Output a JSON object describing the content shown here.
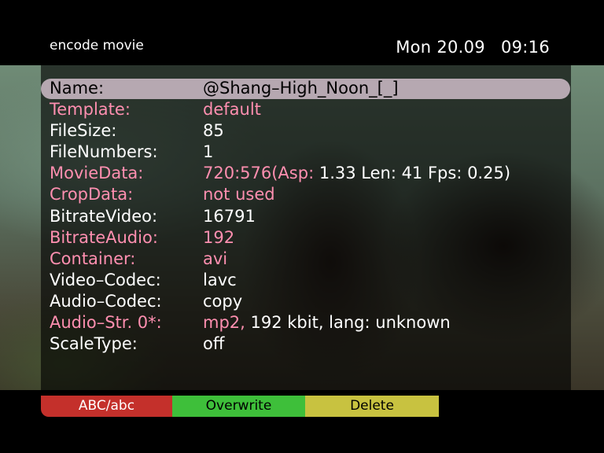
{
  "header": {
    "title": "encode movie",
    "date": "Mon 20.09",
    "time": "09:16"
  },
  "fields": [
    {
      "label": "Name:",
      "value": "@Shang–High_Noon_[_]",
      "selected": true
    },
    {
      "label": "Template:",
      "value": "default"
    },
    {
      "label": "FileSize:",
      "value": "85"
    },
    {
      "label": "FileNumbers:",
      "value": "1"
    },
    {
      "label": "MovieData:",
      "value_parts": [
        "720:576(Asp: ",
        "1.33 Len: 41 Fps: 0.25)"
      ]
    },
    {
      "label": "CropData:",
      "value": "not used"
    },
    {
      "label": "BitrateVideo:",
      "value": "16791"
    },
    {
      "label": "BitrateAudio:",
      "value": "192"
    },
    {
      "label": "Container:",
      "value": "avi"
    },
    {
      "label": "Video–Codec:",
      "value": "lavc"
    },
    {
      "label": "Audio–Codec:",
      "value": "copy"
    },
    {
      "label": "Audio–Str. 0*:",
      "value_parts": [
        "mp2, ",
        "192 kbit, lang: unknown"
      ]
    },
    {
      "label": "ScaleType:",
      "value": "off"
    }
  ],
  "buttons": {
    "red": "ABC/abc",
    "green": "Overwrite",
    "yellow": "Delete"
  },
  "colors": {
    "highlight": "#b6a8b1",
    "text_pink": "#ff8fb0",
    "text_white": "#ffffff",
    "button_red": "#c4302b",
    "button_green": "#3ebf3a",
    "button_yellow": "#c8c240"
  }
}
